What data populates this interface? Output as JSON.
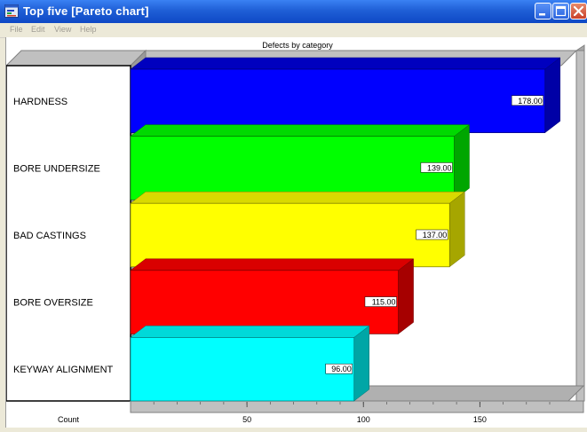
{
  "window": {
    "title": "Top five [Pareto chart]",
    "icon": "chart-window-icon",
    "controls": [
      "minimize-icon",
      "maximize-icon",
      "close-icon"
    ]
  },
  "menu": {
    "items": [
      "File",
      "Edit",
      "View",
      "Help"
    ]
  },
  "colors": {
    "titlebar": "#0e48c5",
    "panel": "#c0c0c0",
    "value_label_bg": "#ffffff"
  },
  "chart_data": {
    "type": "bar",
    "orientation": "horizontal",
    "title": "Defects by category",
    "xlabel": "Count",
    "categories": [
      "HARDNESS",
      "BORE UNDERSIZE",
      "BAD CASTINGS",
      "BORE OVERSIZE",
      "KEYWAY ALIGNMENT"
    ],
    "values": [
      178,
      139,
      137,
      115,
      96
    ],
    "value_labels": [
      "178.00",
      "139.00",
      "137.00",
      "115.00",
      "96.00"
    ],
    "colors": [
      "#0000ff",
      "#00ff00",
      "#ffff00",
      "#ff0000",
      "#00ffff"
    ],
    "xlim": [
      0,
      180
    ],
    "xticks": [
      50,
      100,
      150
    ],
    "minor_tick_step": 10,
    "style": "3d",
    "grid": false,
    "legend": "none"
  }
}
